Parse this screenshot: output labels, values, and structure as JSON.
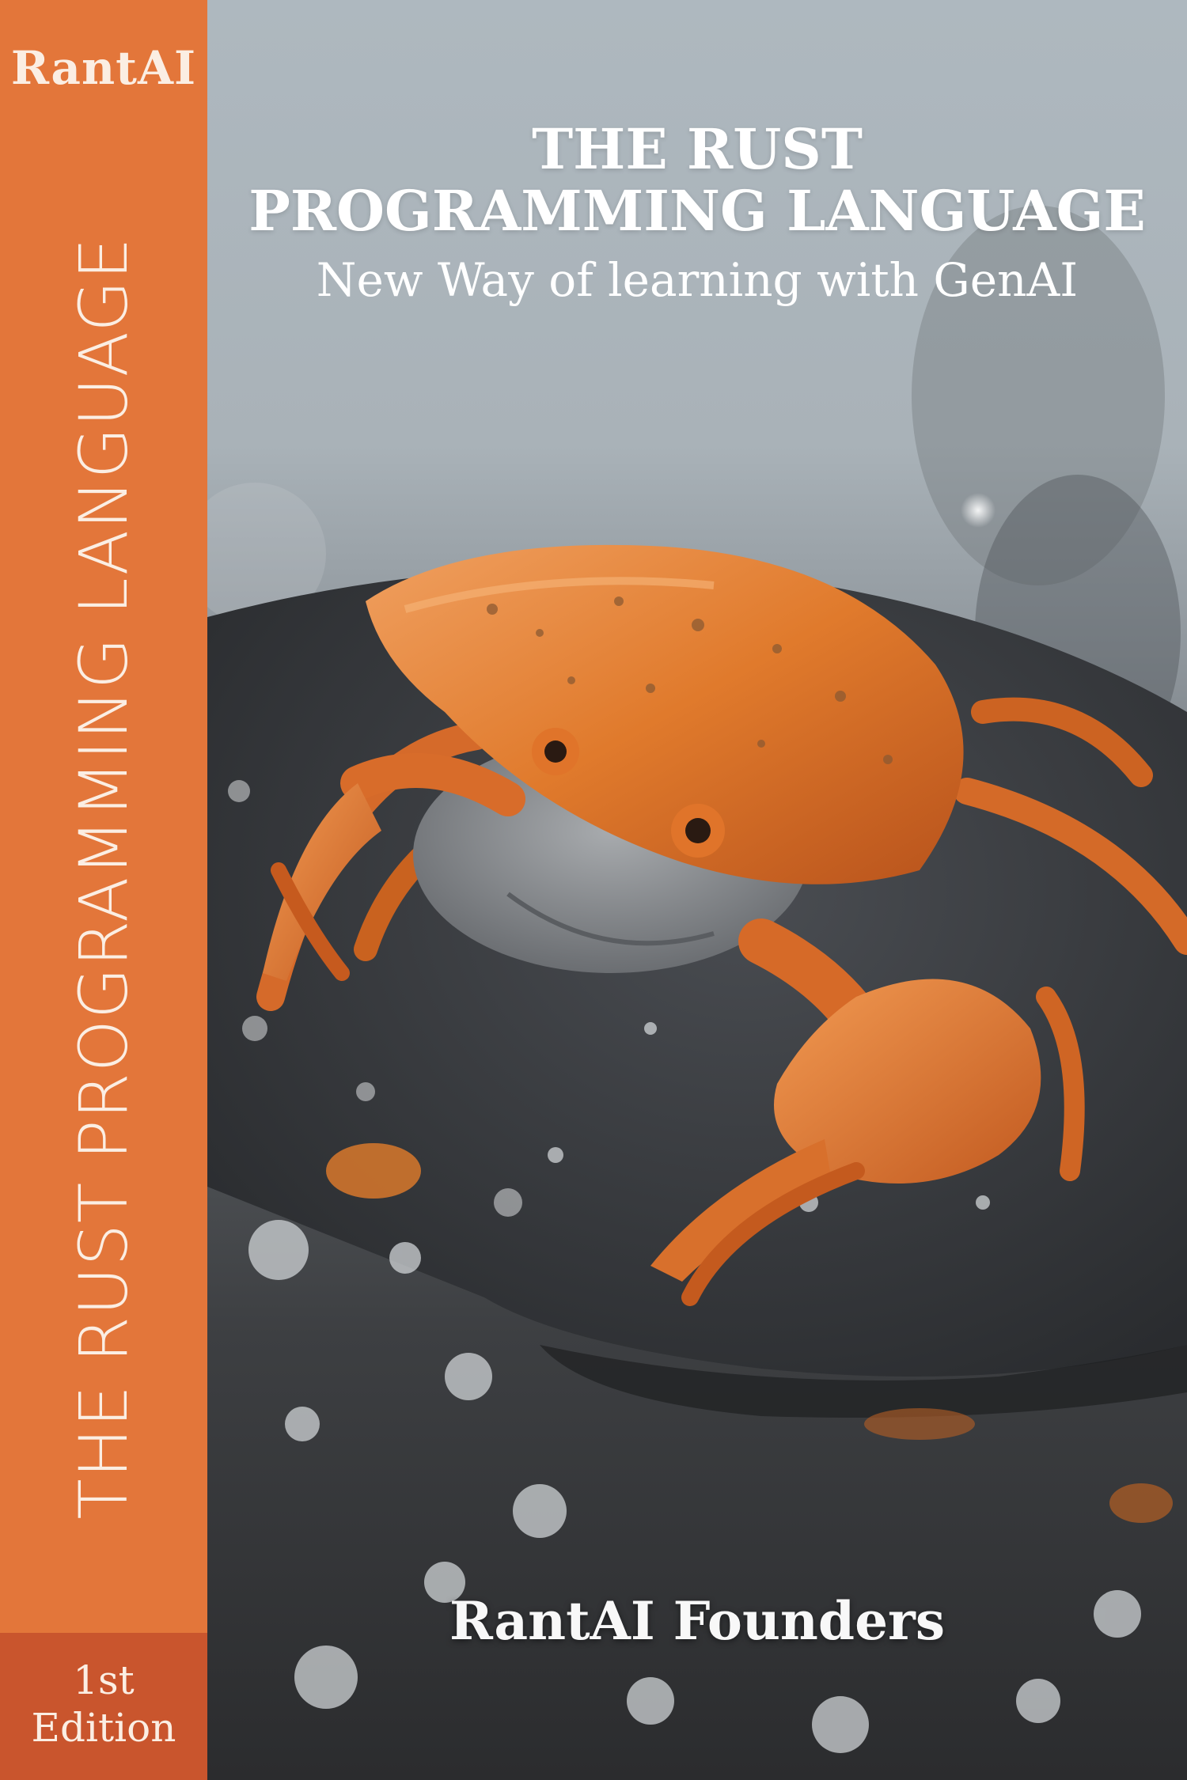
{
  "spine": {
    "publisher": "RantAI",
    "title": "THE RUST PROGRAMMING LANGUAGE",
    "edition_line1": "1st",
    "edition_line2": "Edition"
  },
  "front": {
    "title_line1": "THE RUST",
    "title_line2": "PROGRAMMING LANGUAGE",
    "subtitle": "New Way of learning with GenAI",
    "author": "RantAI Founders"
  },
  "colors": {
    "spine": "#e3763a",
    "edition_block": "#c9552d",
    "crab": "#e0772e",
    "text": "#ffffff"
  },
  "image": "crab-illustration"
}
